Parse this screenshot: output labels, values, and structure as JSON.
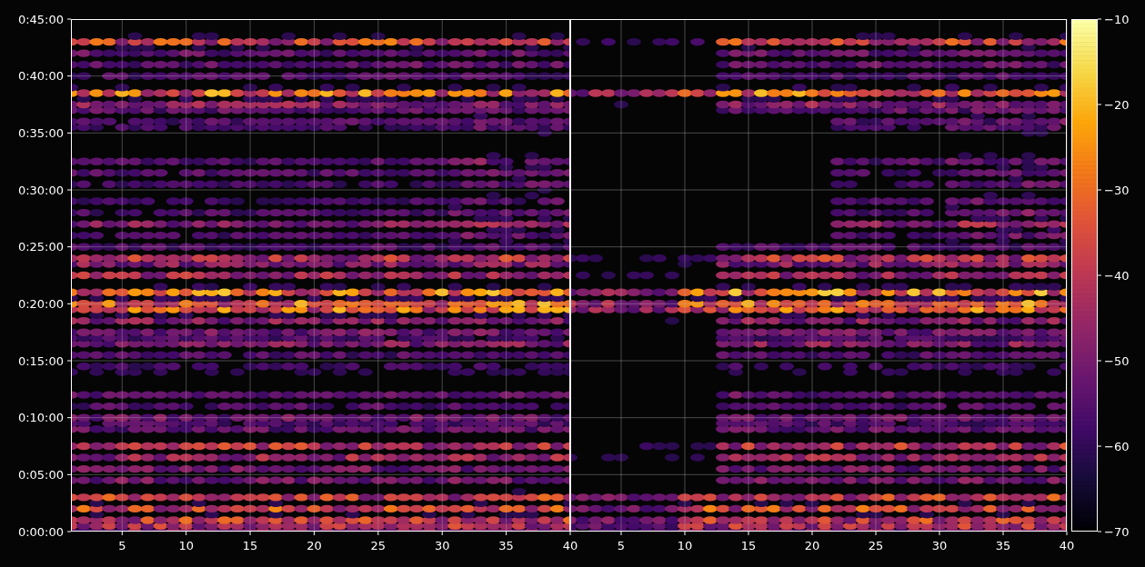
{
  "figure": {
    "y_ticks": [
      "0:45:00",
      "0:40:00",
      "0:35:00",
      "0:30:00",
      "0:25:00",
      "0:20:00",
      "0:15:00",
      "0:10:00",
      "0:05:00",
      "0:00:00"
    ],
    "panels": [
      {
        "x_ticks": [
          "5",
          "10",
          "15",
          "20",
          "25",
          "30",
          "35",
          "40"
        ]
      },
      {
        "x_ticks": [
          "5",
          "10",
          "15",
          "20",
          "25",
          "30",
          "35",
          "40"
        ]
      }
    ],
    "colorbar": {
      "ticks": [
        "−10",
        "−20",
        "−30",
        "−40",
        "−50",
        "−60",
        "−70"
      ]
    }
  }
}
